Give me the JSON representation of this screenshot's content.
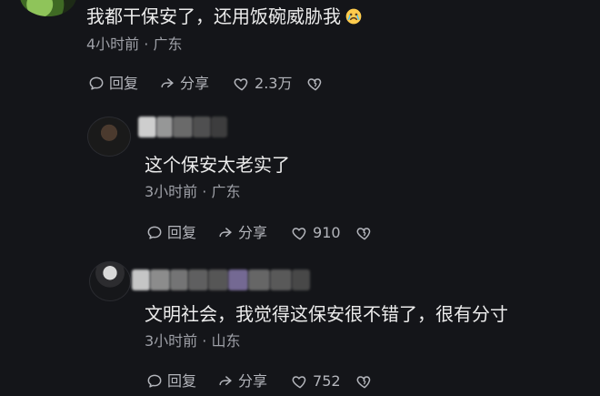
{
  "comments": [
    {
      "text": "我都干保安了，还用饭碗威胁我",
      "meta": "4小时前 · 广东",
      "actions": {
        "reply": "回复",
        "share": "分享",
        "likes": "2.3万"
      }
    },
    {
      "text": "这个保安太老实了",
      "meta": "3小时前 · 广东",
      "actions": {
        "reply": "回复",
        "share": "分享",
        "likes": "910"
      }
    },
    {
      "text": "文明社会，我觉得这保安很不错了，很有分寸",
      "meta": "3小时前 · 山东",
      "actions": {
        "reply": "回复",
        "share": "分享",
        "likes": "752"
      }
    }
  ],
  "icons": {
    "reply": "comment-bubble-icon",
    "share": "share-icon",
    "like": "heart-icon",
    "dislike": "broken-heart-icon",
    "emoji": "crying-face-icon"
  },
  "colors": {
    "background": "#141519",
    "text": "#ececec",
    "meta": "#9ea0a7",
    "action": "#b3b5bb"
  }
}
